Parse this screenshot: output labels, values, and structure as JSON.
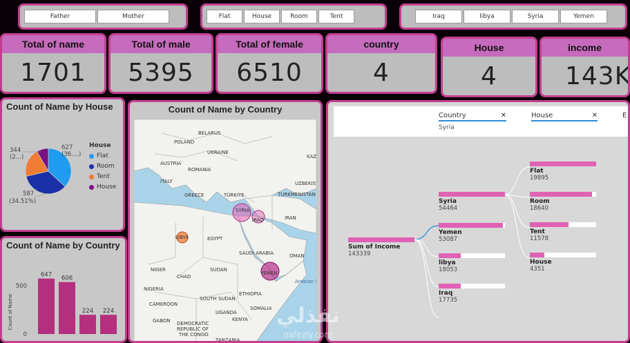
{
  "slicers": {
    "parent": [
      "Father",
      "Mother"
    ],
    "house": [
      "Flat",
      "House",
      "Room",
      "Tent"
    ],
    "country": [
      "Iraq",
      "libya",
      "Syria",
      "Yemen"
    ]
  },
  "cards": [
    {
      "title": "Total of name",
      "value": "1701"
    },
    {
      "title": "Total of male",
      "value": "5395"
    },
    {
      "title": "Total of female",
      "value": "6510"
    },
    {
      "title": "country",
      "value": "4"
    },
    {
      "title": "House",
      "value": "4"
    },
    {
      "title": "income",
      "value": "143K"
    }
  ],
  "pie": {
    "title": "Count of Name by House",
    "legend_title": "House",
    "labels": {
      "top_right": "627",
      "top_right_sub": "(36....)",
      "left": "344",
      "left_sub": "(2...)",
      "bottom": "587",
      "bottom_sub": "(34.51%)"
    },
    "colors": {
      "Flat": "#1f9bf0",
      "Room": "#1b2fa6",
      "Tent": "#f07b33",
      "House": "#7a1180"
    }
  },
  "map": {
    "title": "Count of Name by Country",
    "labels": [
      "BELARUS",
      "POLAND",
      "UKRAINE",
      "AUSTRIA",
      "ROMANIA",
      "ITALY",
      "GREECE",
      "TÜRKIYE",
      "TURKMENISTAN",
      "UZBEKISTA",
      "SYRIA",
      "IRAQ",
      "IRAN",
      "LIBYA",
      "EGYPT",
      "SAUDI ARABIA",
      "OMAN",
      "NIGER",
      "CHAD",
      "SUDAN",
      "YEMEN",
      "NIGERIA",
      "SOUTH SUDAN",
      "ETHIOPIA",
      "CAMEROON",
      "UGANDA",
      "KENYA",
      "SOMALIA",
      "GABON",
      "DEMOCRATIC",
      "REPUBLIC OF",
      "THE CONGO",
      "TANZANIA",
      "KAZ",
      "Arabian S"
    ]
  },
  "bar": {
    "title": "Count of Name by Country",
    "ylabel": "Count of Name",
    "ticks": [
      "500",
      "0"
    ]
  },
  "chart_data": [
    {
      "type": "pie",
      "title": "Count of Name by House",
      "categories": [
        "Flat",
        "Room",
        "Tent",
        "House"
      ],
      "values": [
        627,
        587,
        344,
        143
      ]
    },
    {
      "type": "bar",
      "title": "Count of Name by Country",
      "ylabel": "Count of Name",
      "values": [
        647,
        606,
        224,
        224
      ],
      "ylim": [
        0,
        700
      ]
    }
  ],
  "decomp": {
    "filters": [
      {
        "label": "Country",
        "value": "Syria"
      },
      {
        "label": "House",
        "value": ""
      },
      {
        "label": "E",
        "value": ""
      }
    ],
    "root": {
      "name": "Sum of Income",
      "value": "143339"
    },
    "countries": [
      {
        "name": "Syria",
        "value": "54464",
        "frac": 1.0
      },
      {
        "name": "Yemen",
        "value": "53087",
        "frac": 0.97
      },
      {
        "name": "libya",
        "value": "18053",
        "frac": 0.33
      },
      {
        "name": "Iraq",
        "value": "17735",
        "frac": 0.33
      }
    ],
    "houses": [
      {
        "name": "Flat",
        "value": "19895",
        "frac": 1.0
      },
      {
        "name": "Room",
        "value": "18640",
        "frac": 0.94
      },
      {
        "name": "Tent",
        "value": "11578",
        "frac": 0.58
      },
      {
        "name": "House",
        "value": "4351",
        "frac": 0.22
      }
    ]
  },
  "watermark": {
    "ar": "نفذلي",
    "en": "nafezly.com"
  }
}
